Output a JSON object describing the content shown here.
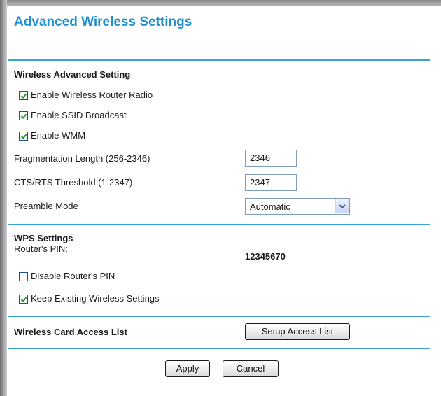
{
  "page": {
    "title": "Advanced Wireless Settings"
  },
  "wireless_advanced": {
    "section_title": "Wireless Advanced Setting",
    "checkboxes": [
      {
        "label": "Enable Wireless Router Radio",
        "checked": true
      },
      {
        "label": "Enable SSID Broadcast",
        "checked": true
      },
      {
        "label": "Enable WMM",
        "checked": true
      }
    ],
    "fragmentation": {
      "label": "Fragmentation Length (256-2346)",
      "value": "2346"
    },
    "cts_rts": {
      "label": "CTS/RTS Threshold (1-2347)",
      "value": "2347"
    },
    "preamble": {
      "label": "Preamble Mode",
      "selected": "Automatic"
    }
  },
  "wps": {
    "section_title": "WPS Settings",
    "pin_label": "Router's PIN:",
    "pin_value": "12345670",
    "checkboxes": [
      {
        "label": "Disable Router's PIN",
        "checked": false
      },
      {
        "label": "Keep Existing Wireless Settings",
        "checked": true
      }
    ]
  },
  "access_list": {
    "label": "Wireless Card Access List",
    "button_label": "Setup Access List"
  },
  "actions": {
    "apply_label": "Apply",
    "cancel_label": "Cancel"
  },
  "colors": {
    "title": "#1f8fd0",
    "divider": "#3aa0d8",
    "checkbox_border": "#1c5180",
    "checkmark": "#1f9a32"
  },
  "icons": [
    "checkmark-icon",
    "chevron-down-icon"
  ]
}
